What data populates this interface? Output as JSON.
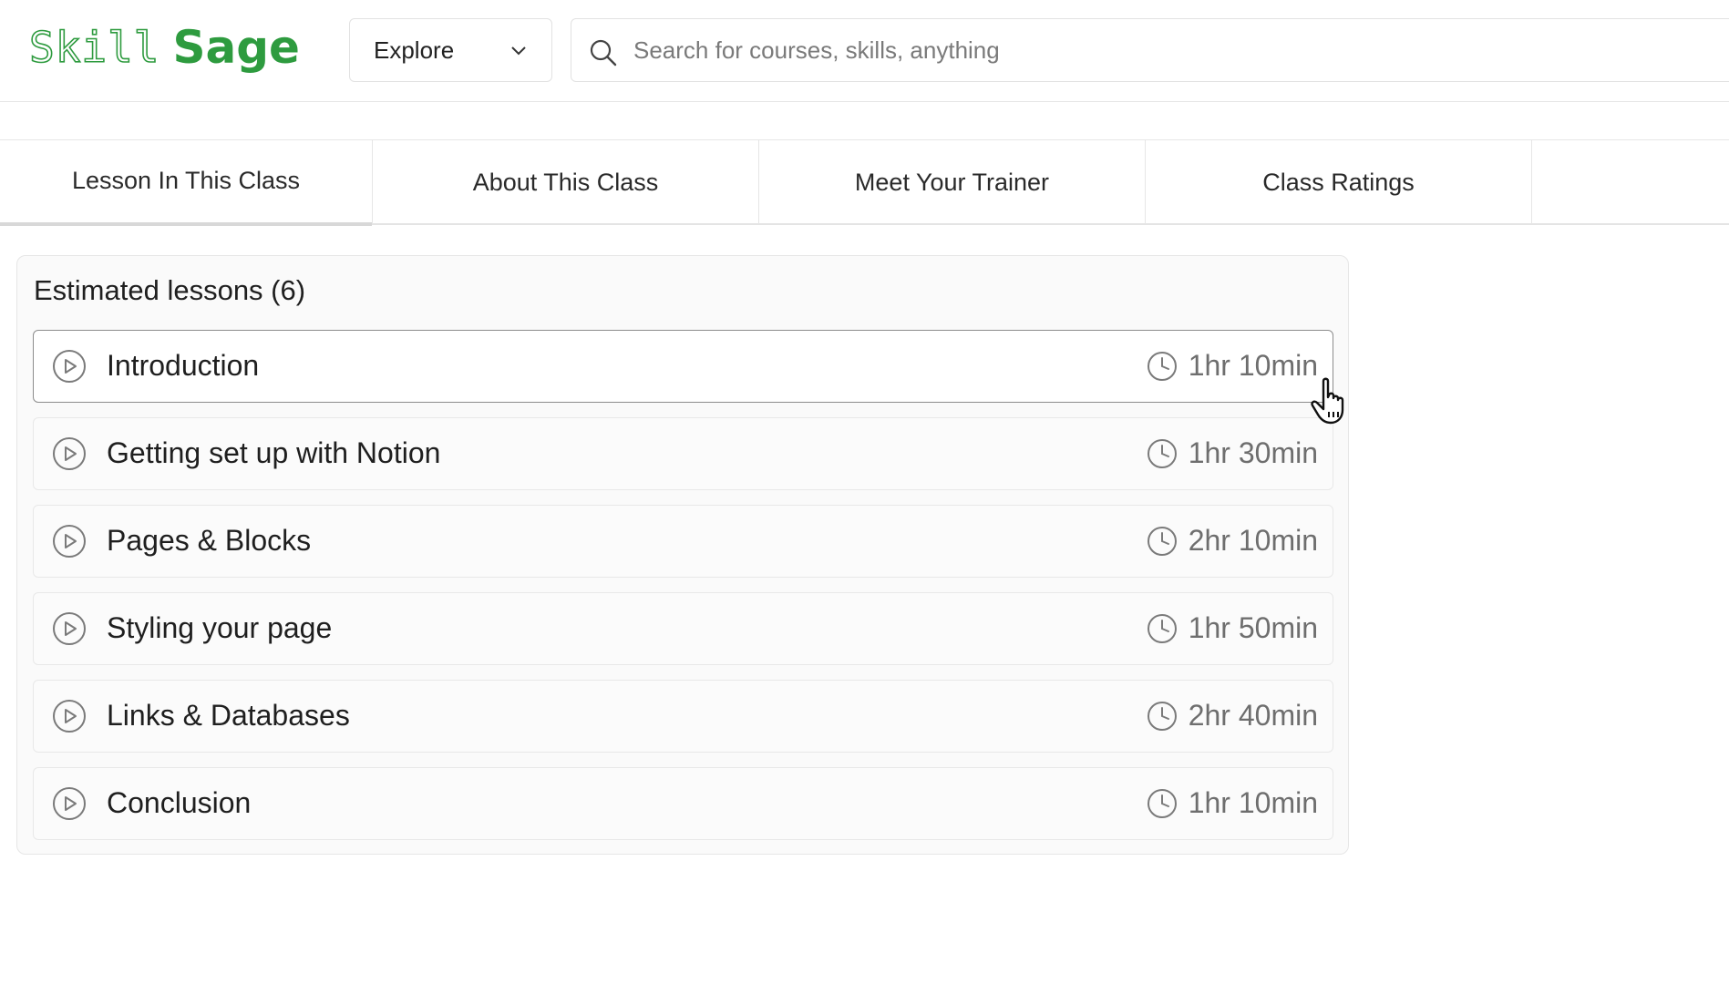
{
  "header": {
    "logo": {
      "part1": "Skill",
      "part2": "Sage"
    },
    "explore_label": "Explore",
    "search_placeholder": "Search for courses, skills, anything"
  },
  "tabs": [
    {
      "label": "Lesson In This Class",
      "active": true
    },
    {
      "label": "About This Class"
    },
    {
      "label": "Meet Your Trainer"
    },
    {
      "label": "Class Ratings"
    }
  ],
  "lessons_panel": {
    "title": "Estimated lessons (6)",
    "items": [
      {
        "title": "Introduction",
        "duration": "1hr 10min",
        "hovered": true
      },
      {
        "title": "Getting set up with Notion",
        "duration": "1hr 30min"
      },
      {
        "title": "Pages & Blocks",
        "duration": "2hr 10min"
      },
      {
        "title": "Styling your page",
        "duration": "1hr 50min"
      },
      {
        "title": "Links & Databases",
        "duration": "2hr 40min"
      },
      {
        "title": "Conclusion",
        "duration": "1hr 10min"
      }
    ]
  },
  "colors": {
    "brand": "#2e9b3f",
    "muted": "#6e6e6e",
    "border": "#e6e6e6"
  }
}
